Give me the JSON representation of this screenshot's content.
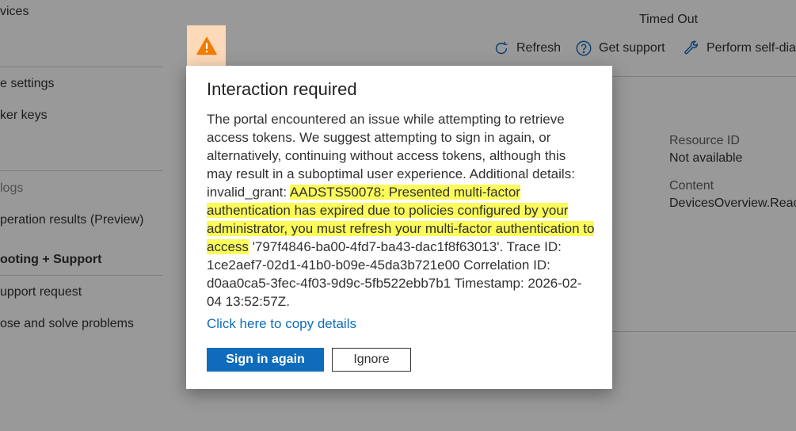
{
  "sidebar": {
    "items": [
      {
        "label": "vices"
      },
      {
        "label": "e settings"
      },
      {
        "label": "ker keys"
      },
      {
        "label": "logs"
      },
      {
        "label": "peration results (Preview)"
      },
      {
        "label": "ooting + Support"
      },
      {
        "label": "upport request"
      },
      {
        "label": "ose and solve problems"
      }
    ]
  },
  "header": {
    "status": "Timed Out",
    "toolbar": {
      "refresh": "Refresh",
      "get_support": "Get support",
      "self_diagnose": "Perform self-dia"
    }
  },
  "details": {
    "resource_id_label": "Resource ID",
    "resource_id_value": "Not available",
    "content_label": "Content",
    "content_value": "DevicesOverview.React"
  },
  "dialog": {
    "title": "Interaction required",
    "body_prefix": "The portal encountered an issue while attempting to retrieve access tokens. We suggest attempting to sign in again, or alternatively, continuing without access tokens, although this may result in a suboptimal user experience. Additional details: invalid_grant: ",
    "body_highlight": "AADSTS50078: Presented multi-factor authentication has expired due to policies configured by your administrator, you must refresh your multi-factor authentication to access",
    "body_suffix": " '797f4846-ba00-4fd7-ba43-dac1f8f63013'. Trace ID: 1ce2aef7-02d1-41b0-b09e-45da3b721e00 Correlation ID: d0aa0ca5-3fec-4f03-9d9c-5fb522ebb7b1 Timestamp: 2026-02-04 13:52:57Z.",
    "copy_link": "Click here to copy details",
    "primary_button": "Sign in again",
    "secondary_button": "Ignore"
  },
  "icons": {
    "warning": "warning-icon",
    "refresh": "refresh-icon",
    "support": "help-icon",
    "diagnose": "wrench-icon"
  },
  "colors": {
    "accent": "#0f6cbd",
    "highlight": "#fbfb5a",
    "warning": "#f07c00",
    "warning_bg": "#fcd9b8"
  }
}
